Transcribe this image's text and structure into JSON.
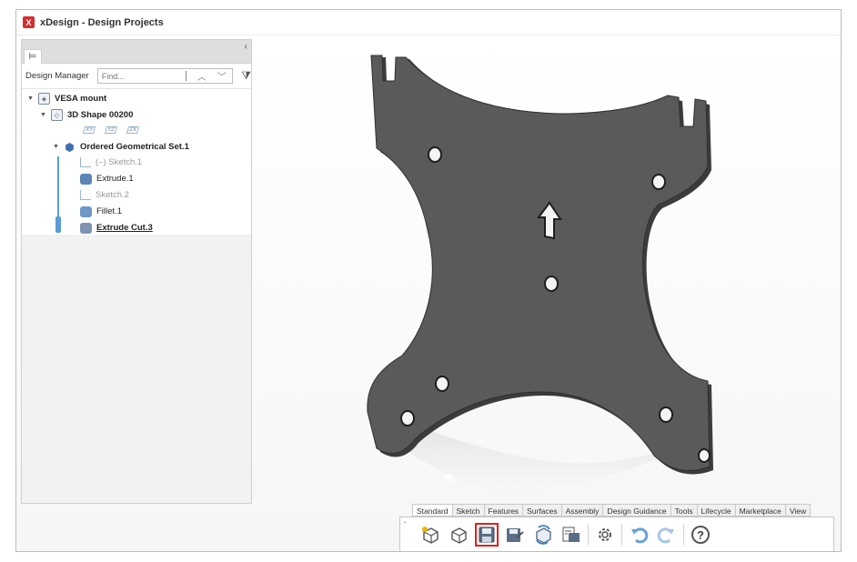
{
  "app": {
    "logo": "X",
    "title": "xDesign - Design Projects"
  },
  "design_manager": {
    "label": "Design Manager",
    "find_placeholder": "Find...",
    "collapse_glyph": "‹",
    "tree_tab_glyph": "⊨"
  },
  "tree": {
    "root": "VESA mount",
    "shape": "3D Shape 00200",
    "planes": [
      "XY",
      "YZ",
      "ZX"
    ],
    "set": "Ordered Geometrical Set.1",
    "items": [
      {
        "label": "(–) Sketch.1"
      },
      {
        "label": "Extrude.1"
      },
      {
        "label": "Sketch.2"
      },
      {
        "label": "Fillet.1"
      },
      {
        "label": "Extrude Cut.3"
      }
    ]
  },
  "toolbar": {
    "tabs": [
      "Standard",
      "Sketch",
      "Features",
      "Surfaces",
      "Assembly",
      "Design Guidance",
      "Tools",
      "Lifecycle",
      "Marketplace",
      "View"
    ],
    "active_tab": "Standard",
    "highlighted_tool": "save-icon",
    "help_glyph": "?"
  },
  "colors": {
    "part": "#5a5a5a",
    "accent": "#5b9bd5",
    "highlight": "#e02020"
  }
}
